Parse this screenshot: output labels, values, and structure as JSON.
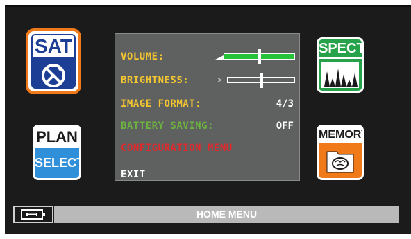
{
  "tiles": {
    "sat": {
      "label": "SAT",
      "icon": "satellite-dish-icon"
    },
    "spect": {
      "label": "SPECT",
      "icon": "spectrum-icon"
    },
    "plan": {
      "top_label": "PLAN",
      "bottom_label": "SELECT"
    },
    "memory": {
      "label": "MEMORY",
      "icon": "brain-folder-icon"
    }
  },
  "menu": {
    "volume": {
      "label": "VOLUME:",
      "level_fraction": 0.5
    },
    "brightness": {
      "label": "BRIGHTNESS:",
      "level_fraction": 0.5
    },
    "image_format": {
      "label": "IMAGE FORMAT:",
      "value": "4/3"
    },
    "battery_saving": {
      "label": "BATTERY SAVING:",
      "value": "OFF"
    },
    "configuration": {
      "label": "CONFIGURATION MENU"
    },
    "exit": {
      "label": "EXIT"
    }
  },
  "status_bar": {
    "title": "HOME MENU"
  },
  "colors": {
    "highlight_orange": "#f07a1a",
    "menu_yellow": "#f2c531",
    "menu_green": "#6cb33f",
    "menu_red": "#e0282b",
    "slider_green": "#26c23a",
    "sat_blue": "#1c3f95",
    "spect_green": "#26a34a",
    "plan_blue": "#2f8fd9"
  }
}
